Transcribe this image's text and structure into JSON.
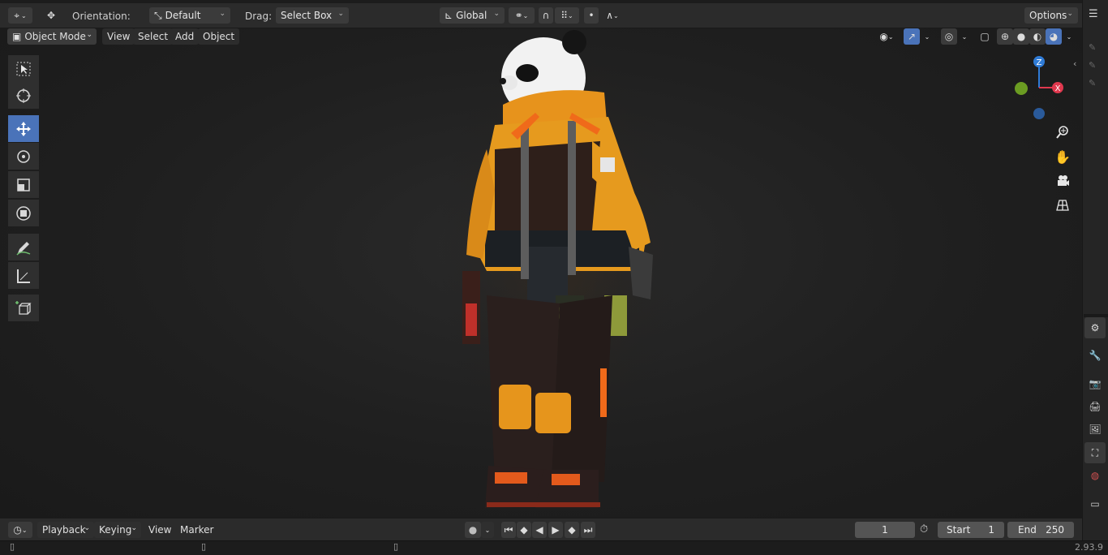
{
  "header": {
    "orientation_label": "Orientation:",
    "orientation_value": "Default",
    "drag_label": "Drag:",
    "drag_value": "Select Box",
    "transform_space": "Global",
    "options_label": "Options"
  },
  "viewport_header": {
    "mode": "Object Mode",
    "menus": [
      "View",
      "Select",
      "Add",
      "Object"
    ]
  },
  "toolbar": {
    "tools": [
      "select-box",
      "cursor",
      "move",
      "rotate",
      "scale",
      "transform",
      "annotate",
      "measure",
      "add-cube"
    ],
    "active_tool": "move"
  },
  "gizmo": {
    "z": "Z",
    "x": "X",
    "colors": {
      "x": "#e0384e",
      "y": "#6b9c22",
      "z": "#2f7bd6",
      "neg_y": "#5a7d1c",
      "neg_z": "#2a5a9a"
    }
  },
  "timeline": {
    "menus": [
      "Playback",
      "Keying",
      "View",
      "Marker"
    ],
    "current_frame": "1",
    "start_label": "Start",
    "start_value": "1",
    "end_label": "End",
    "end_value": "250"
  },
  "status": {
    "version": "2.93.9"
  },
  "colors": {
    "accent": "#4a73b9",
    "viewport_bg": "#1f1f1f",
    "header_bg": "#2b2b2b"
  }
}
